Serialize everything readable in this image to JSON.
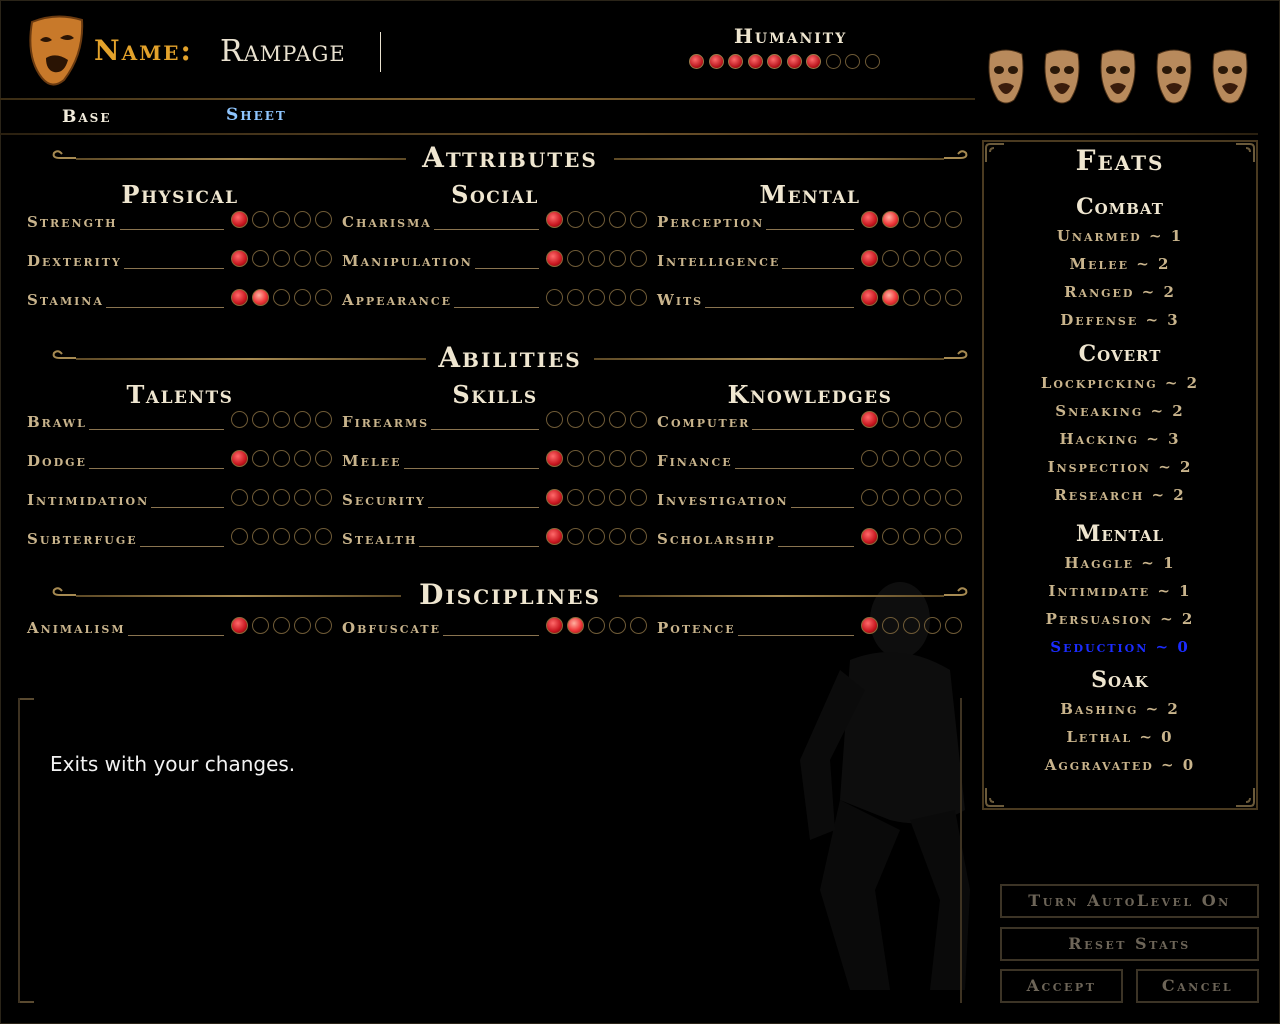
{
  "header": {
    "name_label": "Name:",
    "name_value": "Rampage",
    "humanity_label": "Humanity",
    "humanity": {
      "current": 7,
      "max": 10
    }
  },
  "tabs": {
    "base": "Base",
    "sheet": "Sheet"
  },
  "attributes": {
    "title": "Attributes",
    "columns": [
      {
        "title": "Physical",
        "stats": [
          {
            "label": "Strength",
            "value": 1,
            "max": 5
          },
          {
            "label": "Dexterity",
            "value": 1,
            "max": 5
          },
          {
            "label": "Stamina",
            "value": 2,
            "max": 5
          }
        ]
      },
      {
        "title": "Social",
        "stats": [
          {
            "label": "Charisma",
            "value": 1,
            "max": 5
          },
          {
            "label": "Manipulation",
            "value": 1,
            "max": 5
          },
          {
            "label": "Appearance",
            "value": 0,
            "max": 5
          }
        ]
      },
      {
        "title": "Mental",
        "stats": [
          {
            "label": "Perception",
            "value": 2,
            "max": 5
          },
          {
            "label": "Intelligence",
            "value": 1,
            "max": 5
          },
          {
            "label": "Wits",
            "value": 2,
            "max": 5
          }
        ]
      }
    ]
  },
  "abilities": {
    "title": "Abilities",
    "columns": [
      {
        "title": "Talents",
        "stats": [
          {
            "label": "Brawl",
            "value": 0,
            "max": 5
          },
          {
            "label": "Dodge",
            "value": 1,
            "max": 5
          },
          {
            "label": "Intimidation",
            "value": 0,
            "max": 5
          },
          {
            "label": "Subterfuge",
            "value": 0,
            "max": 5
          }
        ]
      },
      {
        "title": "Skills",
        "stats": [
          {
            "label": "Firearms",
            "value": 0,
            "max": 5
          },
          {
            "label": "Melee",
            "value": 1,
            "max": 5
          },
          {
            "label": "Security",
            "value": 1,
            "max": 5
          },
          {
            "label": "Stealth",
            "value": 1,
            "max": 5
          }
        ]
      },
      {
        "title": "Knowledges",
        "stats": [
          {
            "label": "Computer",
            "value": 1,
            "max": 5
          },
          {
            "label": "Finance",
            "value": 0,
            "max": 5
          },
          {
            "label": "Investigation",
            "value": 0,
            "max": 5
          },
          {
            "label": "Scholarship",
            "value": 1,
            "max": 5
          }
        ]
      }
    ]
  },
  "disciplines": {
    "title": "Disciplines",
    "stats": [
      {
        "label": "Animalism",
        "value": 1,
        "max": 5
      },
      {
        "label": "Obfuscate",
        "value": 2,
        "max": 5
      },
      {
        "label": "Potence",
        "value": 1,
        "max": 5
      }
    ]
  },
  "description": "Exits with your changes.",
  "feats": {
    "title": "Feats",
    "groups": [
      {
        "title": "Combat",
        "items": [
          "Unarmed ~ 1",
          "Melee ~ 2",
          "Ranged ~ 2",
          "Defense ~ 3"
        ]
      },
      {
        "title": "Covert",
        "items": [
          "Lockpicking ~ 2",
          "Sneaking ~ 2",
          "Hacking ~ 3",
          "Inspection ~ 2",
          "Research ~ 2"
        ]
      },
      {
        "title": "Mental",
        "items": [
          "Haggle ~ 1",
          "Intimidate ~ 1",
          "Persuasion ~ 2",
          "Seduction ~ 0"
        ]
      },
      {
        "title": "Soak",
        "items": [
          "Bashing ~ 2",
          "Lethal ~ 0",
          "Aggravated ~ 0"
        ]
      }
    ],
    "highlighted": "Seduction ~ 0",
    "highlight_color": "#1b2cff"
  },
  "buttons": {
    "autolevel": "Turn AutoLevel On",
    "reset": "Reset Stats",
    "accept": "Accept",
    "cancel": "Cancel"
  },
  "colors": {
    "accent_gold": "#e3a22b",
    "tab_active": "#8fc6ff",
    "dot_filled": "#c8161f"
  }
}
